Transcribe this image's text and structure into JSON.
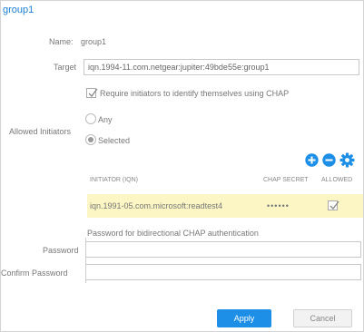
{
  "dialog": {
    "title": "group1"
  },
  "form": {
    "name_label": "Name:",
    "name_value": "group1",
    "target_label": "Target",
    "target_value": "iqn.1994-11.com.netgear:jupiter:49bde55e:group1",
    "require_chap_label": "Require initiators to identify themselves using CHAP",
    "require_chap_checked": true,
    "allowed_initiators_label": "Allowed Initiators",
    "any_label": "Any",
    "selected_label": "Selected",
    "selected_option": "Selected"
  },
  "toolbar": {
    "add_icon": "plus-circle-icon",
    "remove_icon": "minus-circle-icon",
    "settings_icon": "gear-icon",
    "accent_color": "#1e8fe6"
  },
  "table": {
    "columns": [
      "INITIATOR (IQN)",
      "CHAP SECRET",
      "ALLOWED"
    ],
    "rows": [
      {
        "initiator": "iqn.1991-05.com.microsoft:readtest4",
        "chap_secret": "••••••",
        "allowed": true,
        "highlight_color": "#fbf6c4"
      }
    ]
  },
  "mutual_chap": {
    "description": "Password for bidirectional CHAP authentication",
    "password_label": "Password",
    "password_value": "",
    "confirm_label": "Confirm Password",
    "confirm_value": ""
  },
  "buttons": {
    "apply": "Apply",
    "cancel": "Cancel"
  }
}
